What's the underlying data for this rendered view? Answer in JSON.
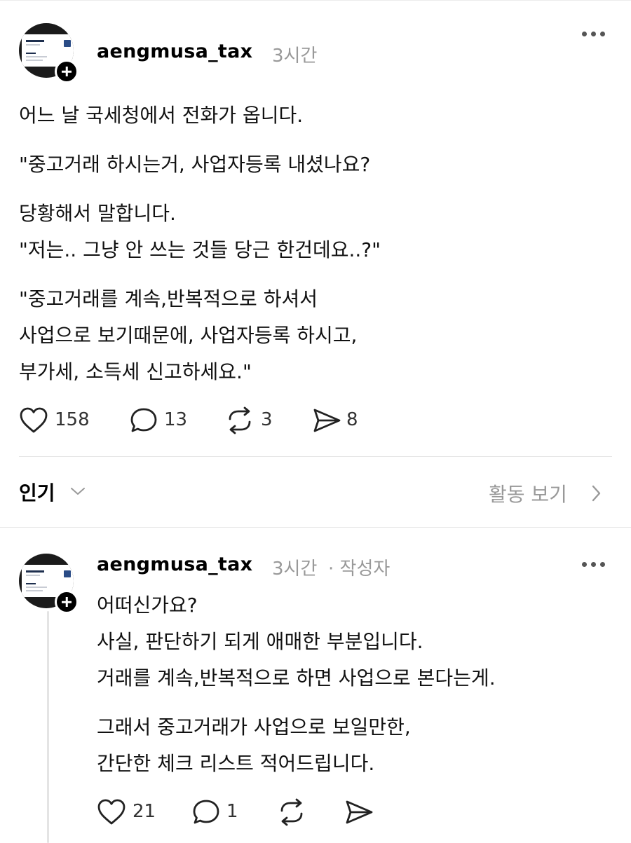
{
  "post": {
    "username": "aengmusa_tax",
    "time": "3시간",
    "lines": [
      "어느 날 국세청에서 전화가 옵니다.",
      "\"중고거래 하시는거, 사업자등록 내셨나요?",
      "당황해서 말합니다.",
      "\"저는.. 그냥 안 쓰는 것들 당근 한건데요..?\"",
      "\"중고거래를 계속,반복적으로 하셔서",
      "사업으로 보기때문에, 사업자등록 하시고,",
      "부가세, 소득세 신고하세요.\""
    ],
    "likes": "158",
    "comments": "13",
    "reposts": "3",
    "shares": "8"
  },
  "sort": {
    "label": "인기",
    "activity_label": "활동 보기"
  },
  "reply": {
    "username": "aengmusa_tax",
    "time": "3시간",
    "author_tag": "· 작성자",
    "lines": [
      "어떠신가요?",
      "사실, 판단하기 되게 애매한 부분입니다.",
      "거래를 계속,반복적으로 하면 사업으로 본다는게.",
      "그래서 중고거래가 사업으로 보일만한,",
      "간단한 체크 리스트 적어드립니다."
    ],
    "likes": "21",
    "comments": "1"
  },
  "colors": {
    "text": "#111111",
    "muted": "#999999",
    "divider": "#e6e6e6"
  }
}
